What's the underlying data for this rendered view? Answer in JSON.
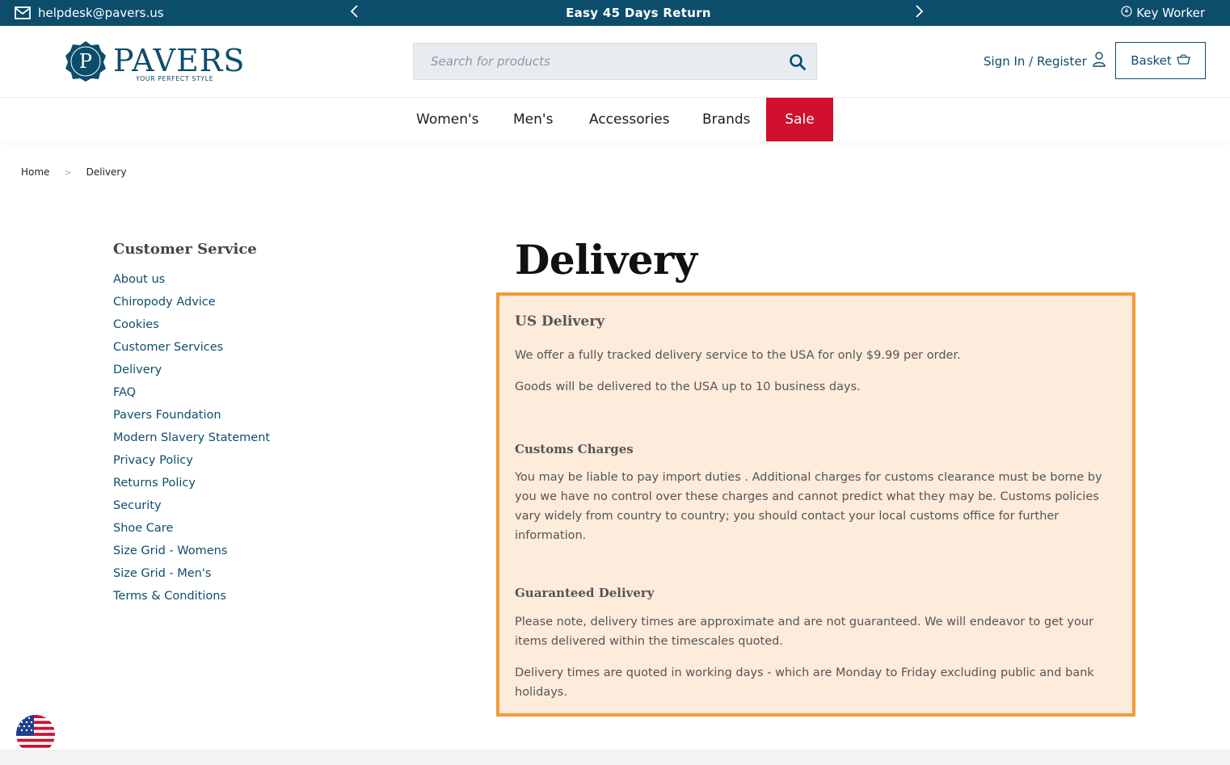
{
  "topbar": {
    "email": "helpdesk@pavers.us",
    "promo": "Easy 45 Days Return",
    "key_worker": "Key Worker"
  },
  "header": {
    "logo_text": "PAVERS",
    "logo_tagline": "YOUR PERFECT STYLE",
    "logo_letter": "P",
    "search_placeholder": "Search for products",
    "signin_label": "Sign In / Register",
    "basket_label": "Basket"
  },
  "nav": {
    "items": [
      {
        "label": "Women's"
      },
      {
        "label": "Men's"
      },
      {
        "label": "Accessories"
      },
      {
        "label": "Brands"
      },
      {
        "label": "Sale"
      }
    ]
  },
  "breadcrumb": {
    "home": "Home",
    "sep": ">",
    "current": "Delivery"
  },
  "sidebar": {
    "title": "Customer Service",
    "links": [
      "About us",
      "Chiropody Advice",
      "Cookies",
      "Customer Services",
      "Delivery",
      "FAQ",
      "Pavers Foundation",
      "Modern Slavery Statement",
      "Privacy Policy",
      "Returns Policy",
      "Security",
      "Shoe Care",
      "Size Grid - Womens",
      "Size Grid - Men's",
      "Terms & Conditions"
    ]
  },
  "main": {
    "title": "Delivery",
    "us_delivery_heading": "US Delivery",
    "us_delivery_p1": "We offer a fully tracked delivery service to the USA for only $9.99 per order.",
    "us_delivery_p2": "Goods will be delivered to the USA up to 10 business days.",
    "customs_heading": "Customs Charges",
    "customs_p1": "You may be liable to pay import duties . Additional charges for customs clearance must be borne by you we have no control over these charges and cannot predict what they may be. Customs policies vary widely from country to country; you should contact your local customs office for further information.",
    "guaranteed_heading": "Guaranteed Delivery",
    "guaranteed_p1": "Please note, delivery times are approximate and are not guaranteed. We will endeavor to get your items delivered within the timescales quoted.",
    "guaranteed_p2": "Delivery times are quoted in working days - which are Monday to Friday excluding public and bank holidays."
  },
  "colors": {
    "brand": "#0d4d6c",
    "sale": "#d0102e",
    "highlight_border": "#f29a38",
    "highlight_fill": "#fdebdb"
  },
  "icons": {
    "email": "mail-icon",
    "prev": "chevron-left-icon",
    "next": "chevron-right-icon",
    "key_worker": "key-worker-icon",
    "search": "search-icon",
    "user": "user-icon",
    "basket": "basket-icon",
    "flag": "us-flag-icon"
  }
}
